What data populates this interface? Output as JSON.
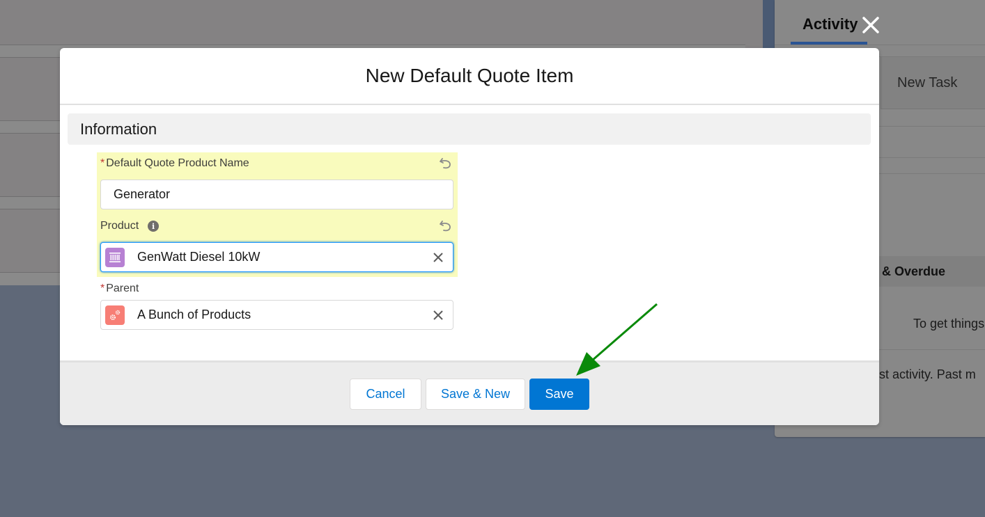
{
  "background": {
    "activity_panel": {
      "tab_label": "Activity",
      "close_icon": "close-icon",
      "new_task_label": "New Task",
      "overdue_label": "& Overdue",
      "empty_state_text": "To get things",
      "past_activity_text": "past activity. Past m"
    }
  },
  "modal": {
    "title": "New Default Quote Item",
    "section_title": "Information",
    "fields": {
      "product_name": {
        "label": "Default Quote Product Name",
        "required": "*",
        "value": "Generator",
        "undo_icon": "undo-icon"
      },
      "product": {
        "label": "Product",
        "info_icon": "i",
        "value": "GenWatt Diesel 10kW",
        "object_icon": "product-icon",
        "icon_color": "#b781d3",
        "undo_icon": "undo-icon",
        "clear_icon": "close-icon"
      },
      "parent": {
        "label": "Parent",
        "required": "*",
        "value": "A Bunch of Products",
        "object_icon": "gears-icon",
        "icon_color": "#f88962",
        "clear_icon": "close-icon"
      }
    },
    "footer": {
      "cancel_label": "Cancel",
      "save_new_label": "Save & New",
      "save_label": "Save"
    }
  },
  "annotation": {
    "arrow_color": "#0a8a0a",
    "points_to": "save-button"
  },
  "colors": {
    "brand": "#0176d3",
    "highlight": "#f9fbbd",
    "required": "#c23934"
  }
}
